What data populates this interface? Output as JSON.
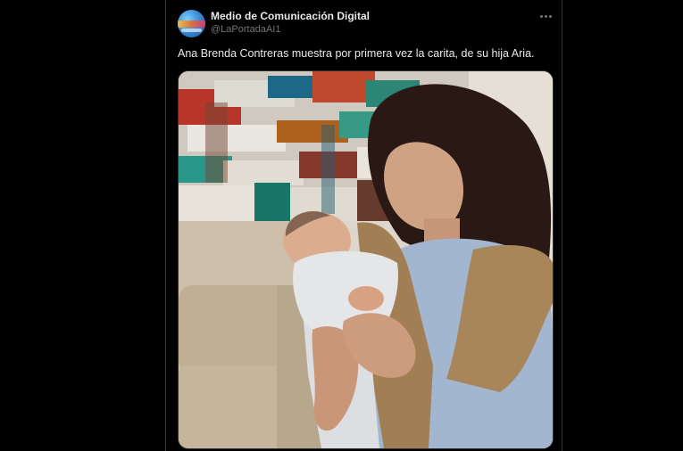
{
  "post": {
    "author": {
      "display_name": "Medio de Comunicación Digital",
      "handle": "@LaPortadaAI1"
    },
    "text": "Ana Brenda Contreras muestra por primera vez la carita, de su hija Aria.",
    "more_icon": "more-horizontal-icon"
  },
  "colors": {
    "background": "#000000",
    "primary_text": "#e7e9ea",
    "secondary_text": "#71767b",
    "border": "#2f3336"
  }
}
